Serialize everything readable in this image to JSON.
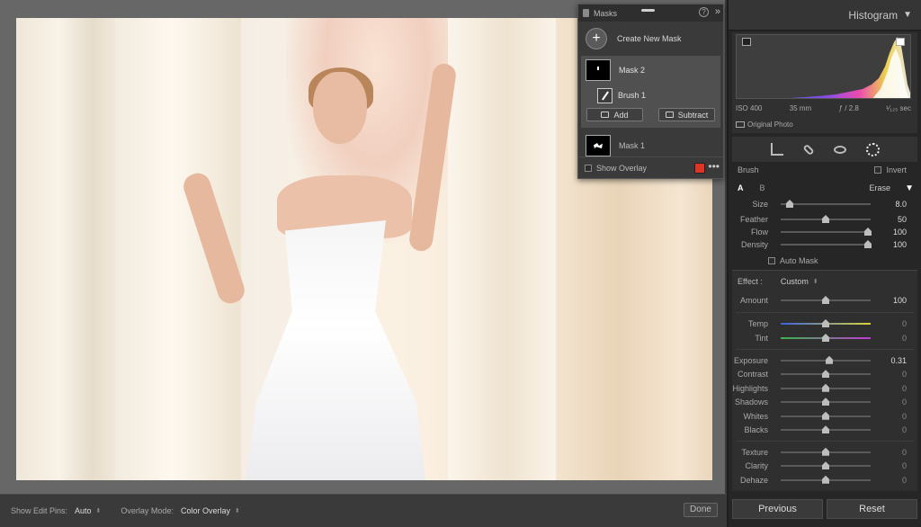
{
  "masks_panel": {
    "title": "Masks",
    "create_label": "Create New Mask",
    "mask2": {
      "name": "Mask 2",
      "brush": "Brush 1",
      "add": "Add",
      "subtract": "Subtract"
    },
    "mask1": {
      "name": "Mask 1"
    },
    "show_overlay": "Show Overlay",
    "overlay_color": "#e03324"
  },
  "toolbar": {
    "pins_label": "Show Edit Pins:",
    "pins_value": "Auto",
    "overlay_label": "Overlay Mode:",
    "overlay_value": "Color Overlay",
    "done": "Done"
  },
  "histogram": {
    "title": "Histogram",
    "iso": "ISO 400",
    "focal": "35 mm",
    "aperture": "ƒ / 2.8",
    "shutter": "¹⁄₁₂₅ sec",
    "original_photo": "Original Photo"
  },
  "brush": {
    "title": "Brush",
    "invert": "Invert",
    "tab_a": "A",
    "tab_b": "B",
    "erase": "Erase",
    "auto_mask": "Auto Mask",
    "params": [
      {
        "label": "Size",
        "value": "8.0",
        "pos": 0.1
      },
      {
        "label": "Feather",
        "value": "50",
        "pos": 0.5
      },
      {
        "label": "Flow",
        "value": "100",
        "pos": 0.97
      },
      {
        "label": "Density",
        "value": "100",
        "pos": 0.97
      }
    ]
  },
  "effect": {
    "label": "Effect :",
    "preset": "Custom",
    "amount": {
      "label": "Amount",
      "value": "100",
      "pos": 0.5
    },
    "color": [
      {
        "label": "Temp",
        "value": "0",
        "pos": 0.5,
        "grad": "linear-gradient(90deg,#3a63d8,#d8d43a)"
      },
      {
        "label": "Tint",
        "value": "0",
        "pos": 0.5,
        "grad": "linear-gradient(90deg,#3ab34a,#c23ad8)"
      }
    ],
    "light": [
      {
        "label": "Exposure",
        "value": "0.31",
        "pos": 0.54
      },
      {
        "label": "Contrast",
        "value": "0",
        "pos": 0.5
      },
      {
        "label": "Highlights",
        "value": "0",
        "pos": 0.5
      },
      {
        "label": "Shadows",
        "value": "0",
        "pos": 0.5
      },
      {
        "label": "Whites",
        "value": "0",
        "pos": 0.5
      },
      {
        "label": "Blacks",
        "value": "0",
        "pos": 0.5
      }
    ],
    "presence": [
      {
        "label": "Texture",
        "value": "0",
        "pos": 0.5
      },
      {
        "label": "Clarity",
        "value": "0",
        "pos": 0.5
      },
      {
        "label": "Dehaze",
        "value": "0",
        "pos": 0.5
      }
    ]
  },
  "footer": {
    "previous": "Previous",
    "reset": "Reset"
  }
}
